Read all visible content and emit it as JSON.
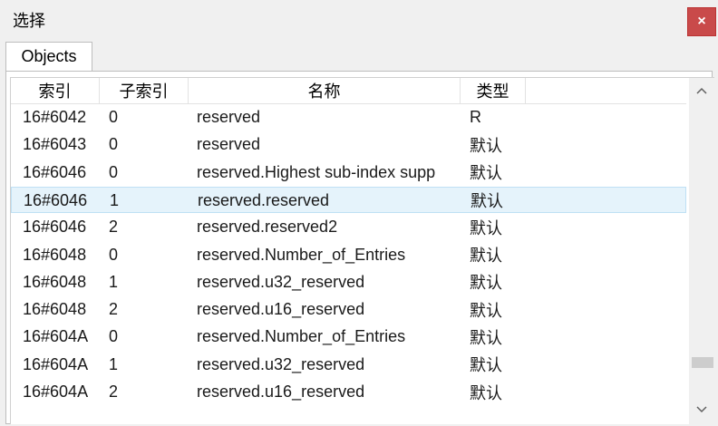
{
  "window": {
    "title": "选择",
    "close_label": "×"
  },
  "tabs": [
    {
      "label": "Objects"
    }
  ],
  "table": {
    "columns": [
      "索引",
      "子索引",
      "名称",
      "类型"
    ],
    "rows": [
      {
        "index": "16#6042",
        "subindex": "0",
        "name": "reserved",
        "type": "R"
      },
      {
        "index": "16#6043",
        "subindex": "0",
        "name": "reserved",
        "type": "默认"
      },
      {
        "index": "16#6046",
        "subindex": "0",
        "name": "reserved.Highest sub-index supp",
        "type": "默认"
      },
      {
        "index": "16#6046",
        "subindex": "1",
        "name": "reserved.reserved",
        "type": "默认"
      },
      {
        "index": "16#6046",
        "subindex": "2",
        "name": "reserved.reserved2",
        "type": "默认"
      },
      {
        "index": "16#6048",
        "subindex": "0",
        "name": "reserved.Number_of_Entries",
        "type": "默认"
      },
      {
        "index": "16#6048",
        "subindex": "1",
        "name": "reserved.u32_reserved",
        "type": "默认"
      },
      {
        "index": "16#6048",
        "subindex": "2",
        "name": "reserved.u16_reserved",
        "type": "默认"
      },
      {
        "index": "16#604A",
        "subindex": "0",
        "name": "reserved.Number_of_Entries",
        "type": "默认"
      },
      {
        "index": "16#604A",
        "subindex": "1",
        "name": "reserved.u32_reserved",
        "type": "默认"
      },
      {
        "index": "16#604A",
        "subindex": "2",
        "name": "reserved.u16_reserved",
        "type": "默认"
      }
    ],
    "selected_row": 3
  },
  "scrollbar": {
    "up_icon": "chevron-up-icon",
    "down_icon": "chevron-down-icon"
  },
  "colors": {
    "close_button": "#c94a4a",
    "selected_row": "#e5f3fb"
  }
}
